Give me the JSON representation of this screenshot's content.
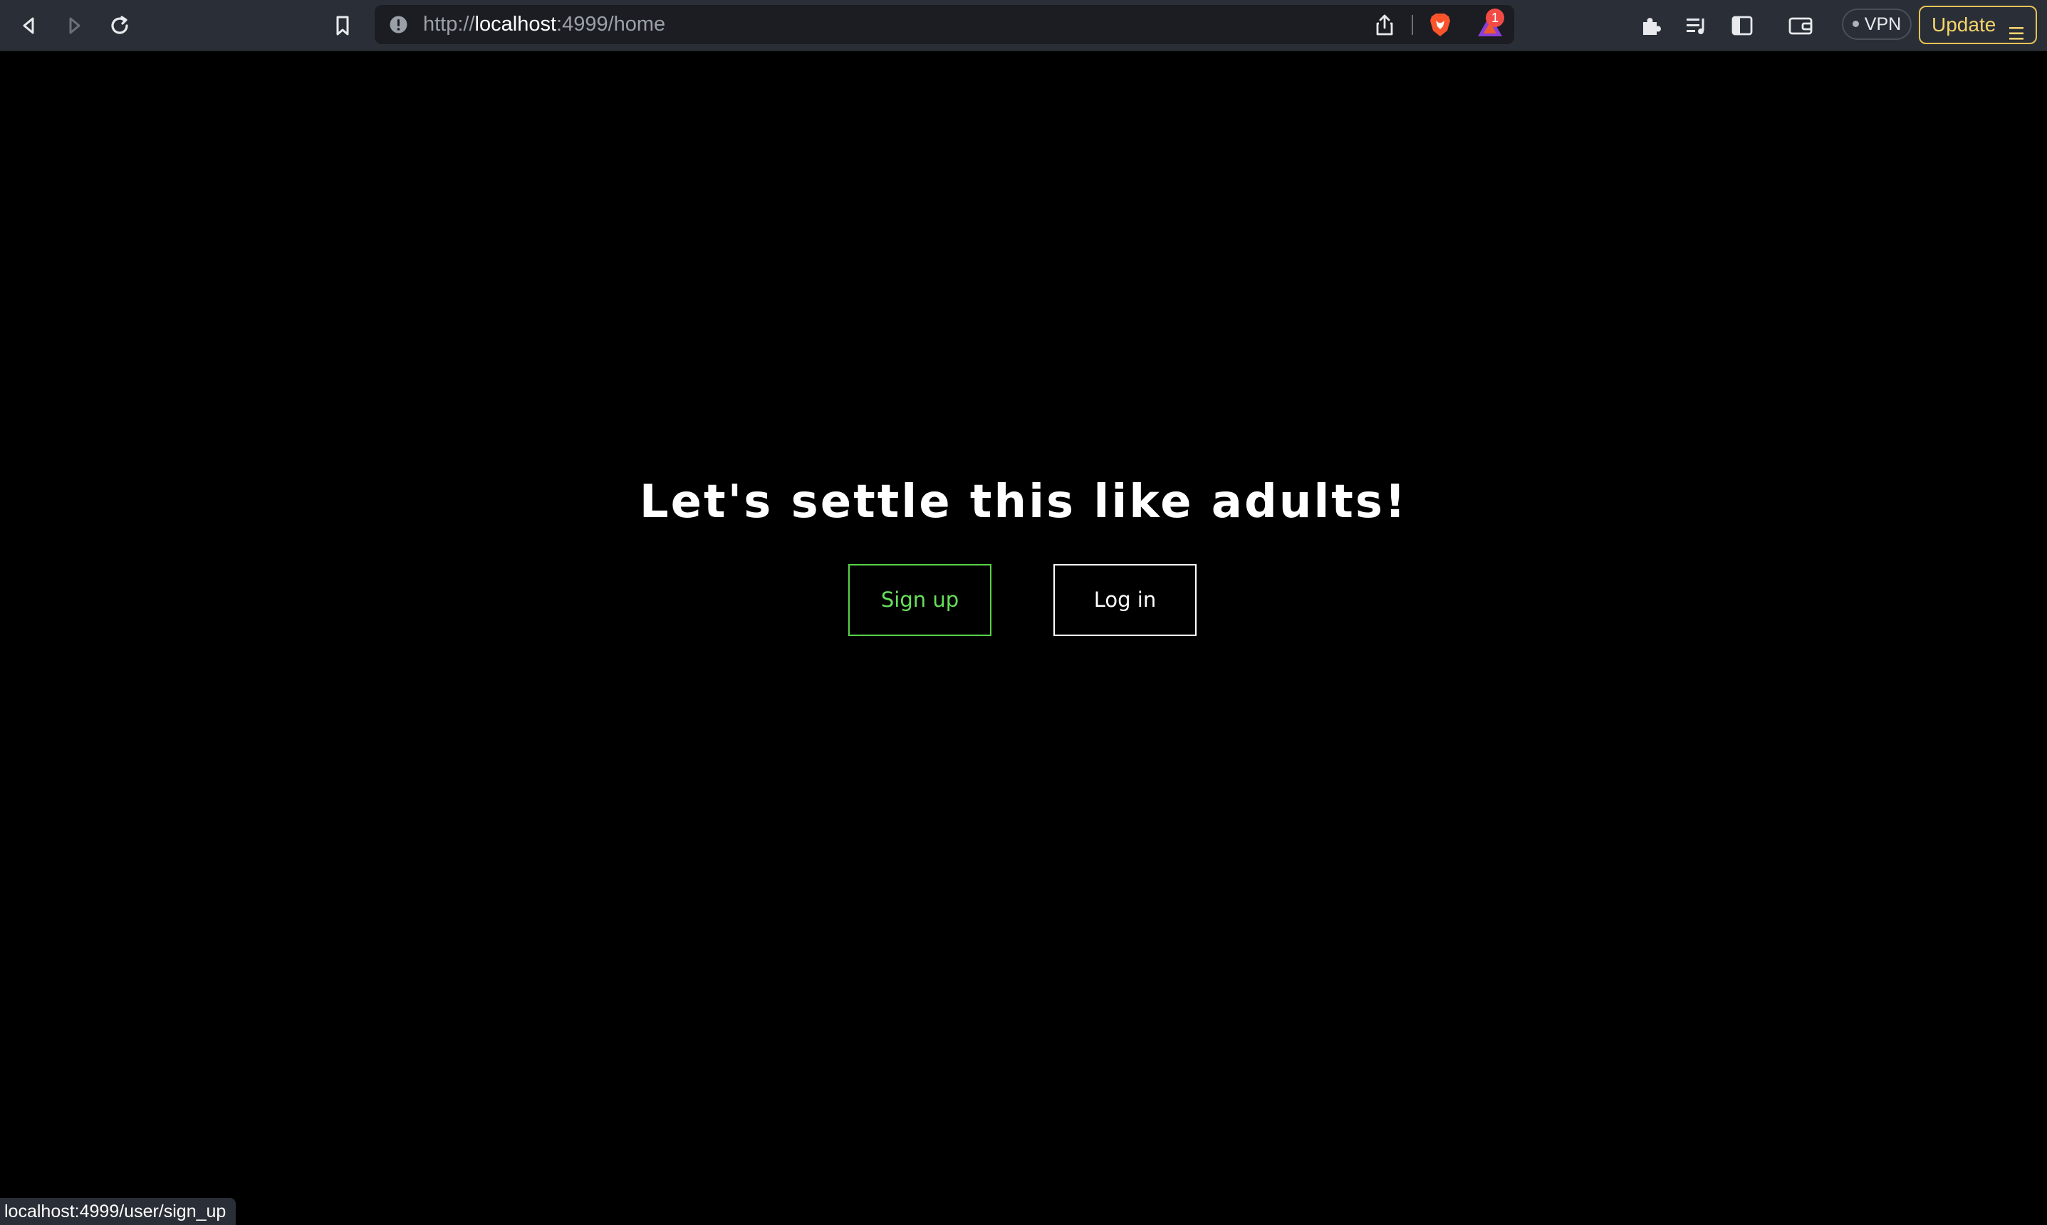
{
  "browser": {
    "url_scheme": "http://",
    "url_host": "localhost",
    "url_rest": ":4999/home",
    "rewards_badge": "1",
    "vpn_label": "VPN",
    "update_label": "Update",
    "status_link": "localhost:4999/user/sign_up",
    "accent_update": "#e8c258"
  },
  "page": {
    "title": "Let's settle this like adults!",
    "signup_label": "Sign up",
    "login_label": "Log in",
    "signup_color": "#66e05a",
    "background": "#000000"
  },
  "icons": {
    "back": "back-arrow-icon",
    "forward": "forward-arrow-icon",
    "reload": "reload-icon",
    "bookmark": "bookmark-icon",
    "site_info": "site-info-icon",
    "share": "share-icon",
    "brave_shields": "brave-lion-icon",
    "rewards": "brave-rewards-icon",
    "extensions": "puzzle-icon",
    "media": "playlist-icon",
    "sidebar": "sidebar-icon",
    "wallet": "wallet-icon",
    "menu": "hamburger-menu-icon"
  }
}
